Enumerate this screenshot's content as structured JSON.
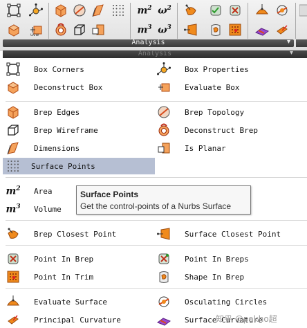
{
  "ribbon": {
    "group_label": "Analysis",
    "pin_icon": "pin-icon"
  },
  "panel": {
    "header_label": "Analysis",
    "items": {
      "box_corners": "Box Corners",
      "box_properties": "Box Properties",
      "deconstruct_box": "Deconstruct Box",
      "evaluate_box": "Evaluate Box",
      "brep_edges": "Brep Edges",
      "brep_topology": "Brep Topology",
      "brep_wireframe": "Brep Wireframe",
      "deconstruct_brep": "Deconstruct Brep",
      "dimensions": "Dimensions",
      "is_planar": "Is Planar",
      "surface_points": "Surface Points",
      "area": "Area",
      "volume": "Volume",
      "brep_closest_point": "Brep Closest Point",
      "surface_closest_point": "Surface Closest Point",
      "point_in_brep": "Point In Brep",
      "point_in_breps": "Point In Breps",
      "point_in_trim": "Point In Trim",
      "shape_in_brep": "Shape In Brep",
      "evaluate_surface": "Evaluate Surface",
      "osculating_circles": "Osculating Circles",
      "principal_curvature": "Principal Curvature",
      "surface_curvature": "Surface Curvature"
    },
    "highlighted": "Surface Points"
  },
  "tooltip": {
    "title": "Surface Points",
    "body": "Get the control-points of a Nurbs Surface"
  },
  "watermark": "知乎 @pakho超",
  "colors": {
    "highlight": "#b6bfd3",
    "orange": "#f08a1c",
    "dark_bar": "#3a3a3a"
  }
}
